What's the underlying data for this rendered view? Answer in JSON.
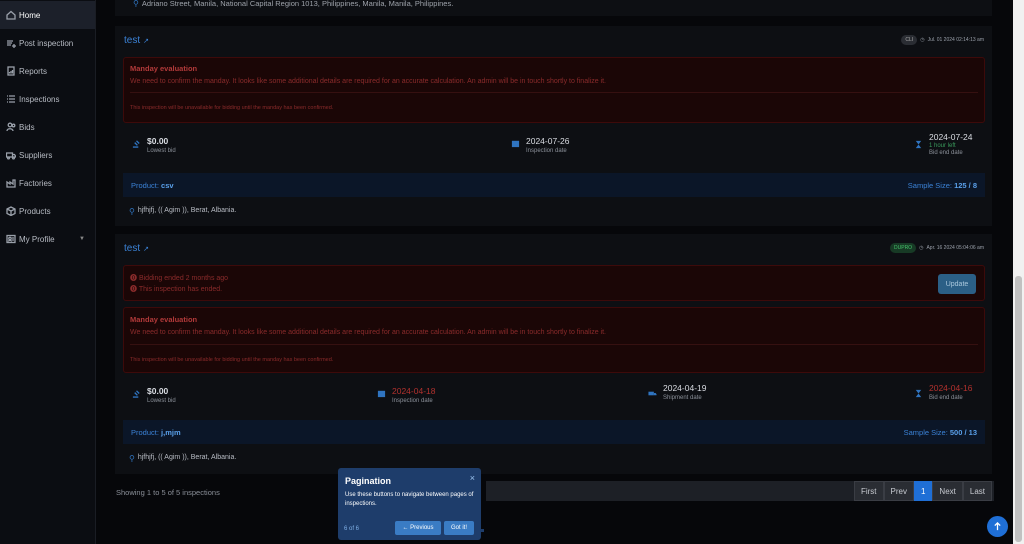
{
  "sidebar": {
    "items": [
      {
        "label": "Home",
        "icon": "home-icon",
        "active": true
      },
      {
        "label": "Post inspection",
        "icon": "plus-doc-icon"
      },
      {
        "label": "Reports",
        "icon": "report-icon"
      },
      {
        "label": "Inspections",
        "icon": "list-icon"
      },
      {
        "label": "Bids",
        "icon": "users-icon"
      },
      {
        "label": "Suppliers",
        "icon": "truck-icon"
      },
      {
        "label": "Factories",
        "icon": "factory-icon"
      },
      {
        "label": "Products",
        "icon": "box-icon"
      },
      {
        "label": "My Profile",
        "icon": "profile-icon",
        "caret": "▼"
      }
    ]
  },
  "top_address": "Adriano Street, Manila, National Capital Region 1013, Philippines, Manila, Manila, Philippines.",
  "cards": [
    {
      "title": "test",
      "badge": "CLI",
      "timestamp": "Jul. 01 2024 02:14:13 am",
      "notice_heading": "Manday evaluation",
      "notice_text": "We need to confirm the manday. It looks like some additional details are required for an accurate calculation. An admin will be in touch shortly to finalize it.",
      "notice_sub": "This inspection will be unavailable for bidding until the manday has been confirmed.",
      "lowest_bid_value": "$0.00",
      "lowest_bid_label": "Lowest bid",
      "inspection_date_value": "2024-07-26",
      "inspection_date_label": "Inspection date",
      "bid_end_value": "2024-07-24",
      "bid_end_note": "1 hour left",
      "bid_end_label": "Bid end date",
      "product_label": "Product:",
      "product_value": "csv",
      "sample_label": "Sample Size:",
      "sample_value": "125 / 8",
      "location": "hjfhjfj, (( Agim )), Berat, Albania."
    },
    {
      "title": "test",
      "badge": "DUPRO",
      "timestamp": "Apr. 16 2024 05:04:06 am",
      "ended_1": "Bidding ended 2 months ago",
      "ended_2": "This inspection has ended.",
      "update_label": "Update",
      "notice_heading": "Manday evaluation",
      "notice_text": "We need to confirm the manday. It looks like some additional details are required for an accurate calculation. An admin will be in touch shortly to finalize it.",
      "notice_sub": "This inspection will be unavailable for bidding until the manday has been confirmed.",
      "lowest_bid_value": "$0.00",
      "lowest_bid_label": "Lowest bid",
      "inspection_date_value": "2024-04-18",
      "inspection_date_label": "Inspection date",
      "shipment_date_value": "2024-04-19",
      "shipment_date_label": "Shipment date",
      "bid_end_value": "2024-04-16",
      "bid_end_label": "Bid end date",
      "product_label": "Product:",
      "product_value": "j,mjm",
      "sample_label": "Sample Size:",
      "sample_value": "500 / 13",
      "location": "hjfhjfj, (( Agim )), Berat, Albania."
    }
  ],
  "showing": "Showing 1 to 5 of 5 inspections",
  "pagination": {
    "first": "First",
    "prev": "Prev",
    "current": "1",
    "next": "Next",
    "last": "Last"
  },
  "tour": {
    "title": "Pagination",
    "body": "Use these buttons to navigate between pages of inspections.",
    "close": "×",
    "step": "6 of 6",
    "prev_label": "← Previous",
    "got_label": "Got it!"
  },
  "fab_icon": "arrow-up-icon",
  "colors": {
    "accent": "#1f6fd6",
    "danger": "#b23a3a",
    "link": "#3b82d6"
  }
}
